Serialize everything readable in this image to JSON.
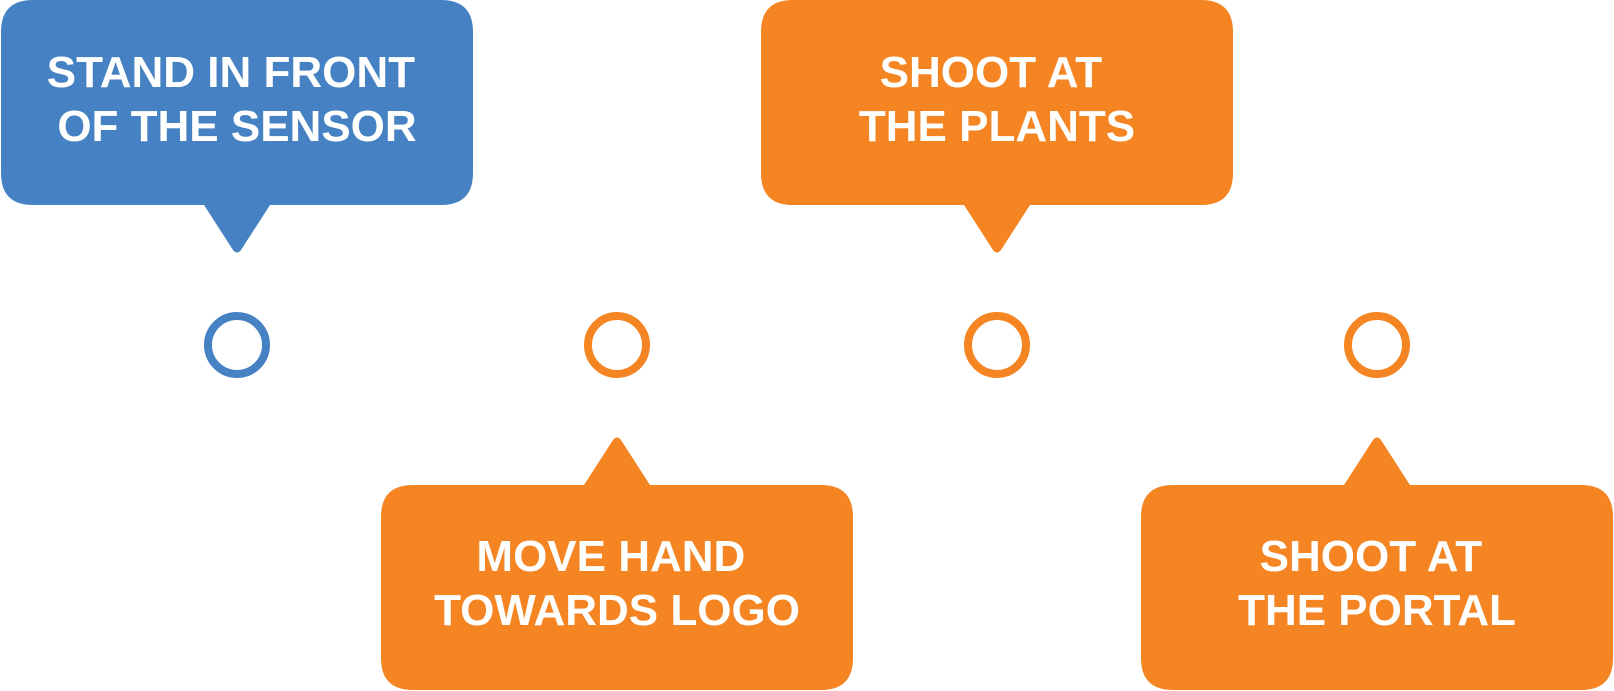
{
  "colors": {
    "blue": "#4682C3",
    "orange": "#F48522",
    "text": "#FFFFFF",
    "line_start": "#7FAAD6",
    "line_end": "#F2A64F"
  },
  "steps": [
    {
      "lines": [
        "STAND IN FRONT",
        "OF THE SENSOR"
      ],
      "color": "blue",
      "position": "above"
    },
    {
      "lines": [
        "MOVE HAND",
        "TOWARDS LOGO"
      ],
      "color": "orange",
      "position": "below"
    },
    {
      "lines": [
        "SHOOT AT",
        "THE PLANTS"
      ],
      "color": "orange",
      "position": "above"
    },
    {
      "lines": [
        "SHOOT AT",
        "THE PORTAL"
      ],
      "color": "orange",
      "position": "below"
    }
  ]
}
